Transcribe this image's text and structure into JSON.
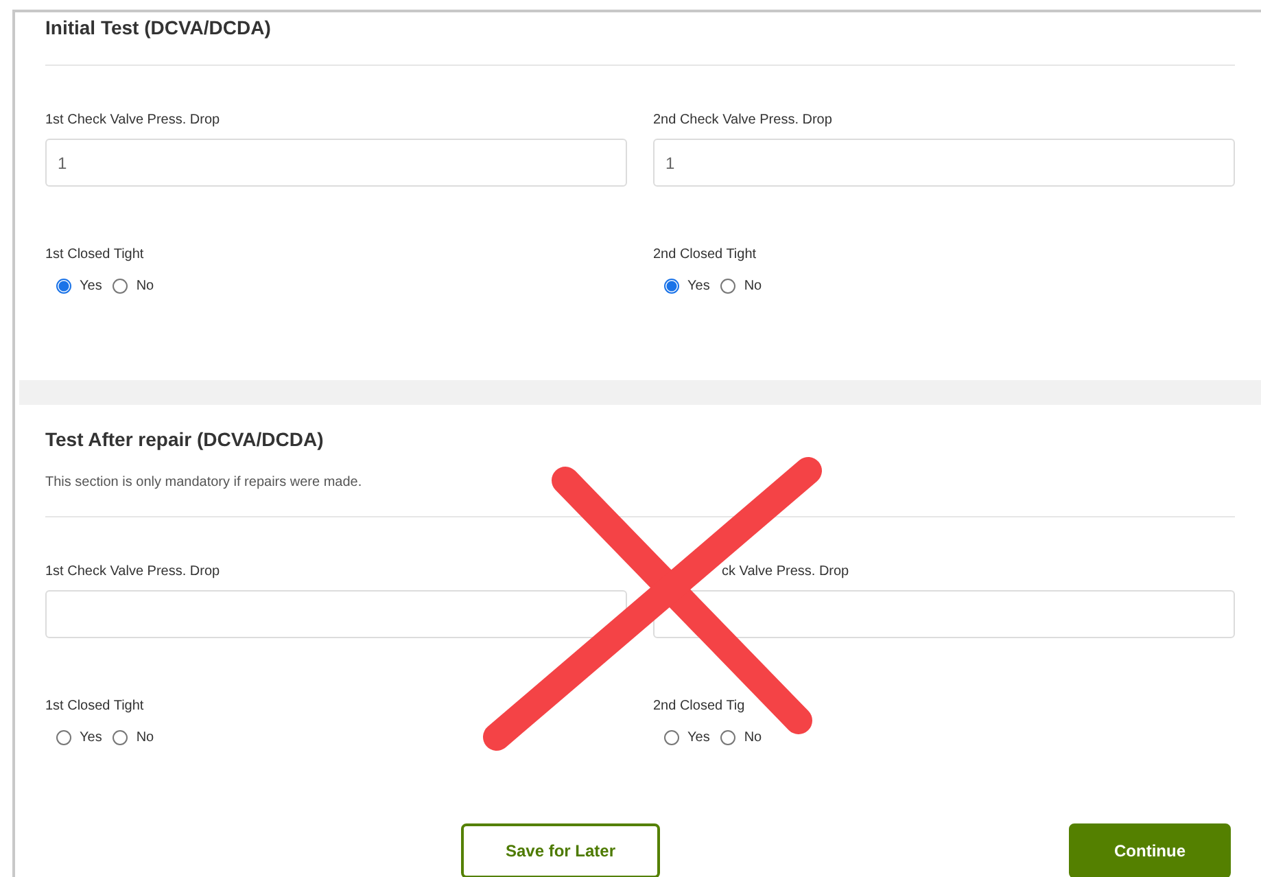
{
  "sections": [
    {
      "title": "Initial Test (DCVA/DCDA)",
      "fields": [
        {
          "kind": "text",
          "label": "1st Check Valve Press. Drop",
          "value": "1"
        },
        {
          "kind": "text",
          "label": "2nd Check Valve Press. Drop",
          "value": "1"
        },
        {
          "kind": "radio",
          "label": "1st Closed Tight",
          "options": [
            {
              "label": "Yes",
              "selected": true
            },
            {
              "label": "No",
              "selected": false
            }
          ]
        },
        {
          "kind": "radio",
          "label": "2nd Closed Tight",
          "options": [
            {
              "label": "Yes",
              "selected": true
            },
            {
              "label": "No",
              "selected": false
            }
          ]
        }
      ]
    },
    {
      "title": "Test After repair (DCVA/DCDA)",
      "note": "This section is only mandatory if repairs were made.",
      "fields": [
        {
          "kind": "text",
          "label": "1st Check Valve Press. Drop"
        },
        {
          "kind": "text",
          "label": "ck Valve Press. Drop"
        },
        {
          "kind": "radio",
          "label": "1st Closed Tight",
          "options": [
            {
              "label": "Yes",
              "selected": false
            },
            {
              "label": "No",
              "selected": false
            }
          ]
        },
        {
          "kind": "radio",
          "label": "2nd Closed Tig",
          "options": [
            {
              "label": "Yes",
              "selected": false
            },
            {
              "label": "No",
              "selected": false
            }
          ]
        }
      ]
    }
  ],
  "buttons": [
    {
      "kind": "outline",
      "label": "Save for Later"
    },
    {
      "kind": "primary",
      "label": "Continue"
    }
  ]
}
